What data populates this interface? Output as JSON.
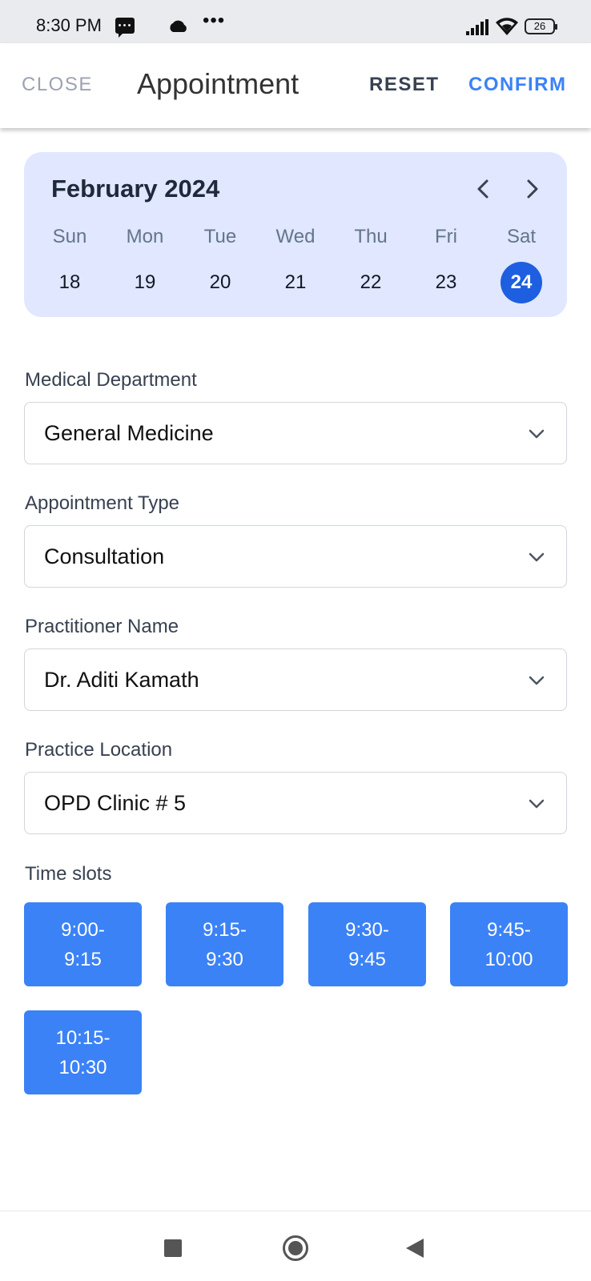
{
  "status_bar": {
    "time": "8:30 PM",
    "battery": "26"
  },
  "app_bar": {
    "close_label": "CLOSE",
    "title": "Appointment",
    "reset_label": "RESET",
    "confirm_label": "CONFIRM"
  },
  "calendar": {
    "month": "February 2024",
    "days": [
      "Sun",
      "Mon",
      "Tue",
      "Wed",
      "Thu",
      "Fri",
      "Sat"
    ],
    "dates": [
      "18",
      "19",
      "20",
      "21",
      "22",
      "23",
      "24"
    ],
    "selected_date": "24"
  },
  "form": {
    "department": {
      "label": "Medical Department",
      "value": "General Medicine"
    },
    "appointment_type": {
      "label": "Appointment Type",
      "value": "Consultation"
    },
    "practitioner": {
      "label": "Practitioner Name",
      "value": "Dr. Aditi Kamath"
    },
    "location": {
      "label": "Practice Location",
      "value": "OPD Clinic # 5"
    }
  },
  "time_slots": {
    "label": "Time slots",
    "slots": [
      {
        "start": "9:00-",
        "end": "9:15"
      },
      {
        "start": "9:15-",
        "end": "9:30"
      },
      {
        "start": "9:30-",
        "end": "9:45"
      },
      {
        "start": "9:45-",
        "end": "10:00"
      },
      {
        "start": "10:15-",
        "end": "10:30"
      }
    ]
  },
  "colors": {
    "accent": "#3b82f6",
    "selected_date": "#1d5fe0",
    "calendar_bg": "#e0e7ff"
  }
}
